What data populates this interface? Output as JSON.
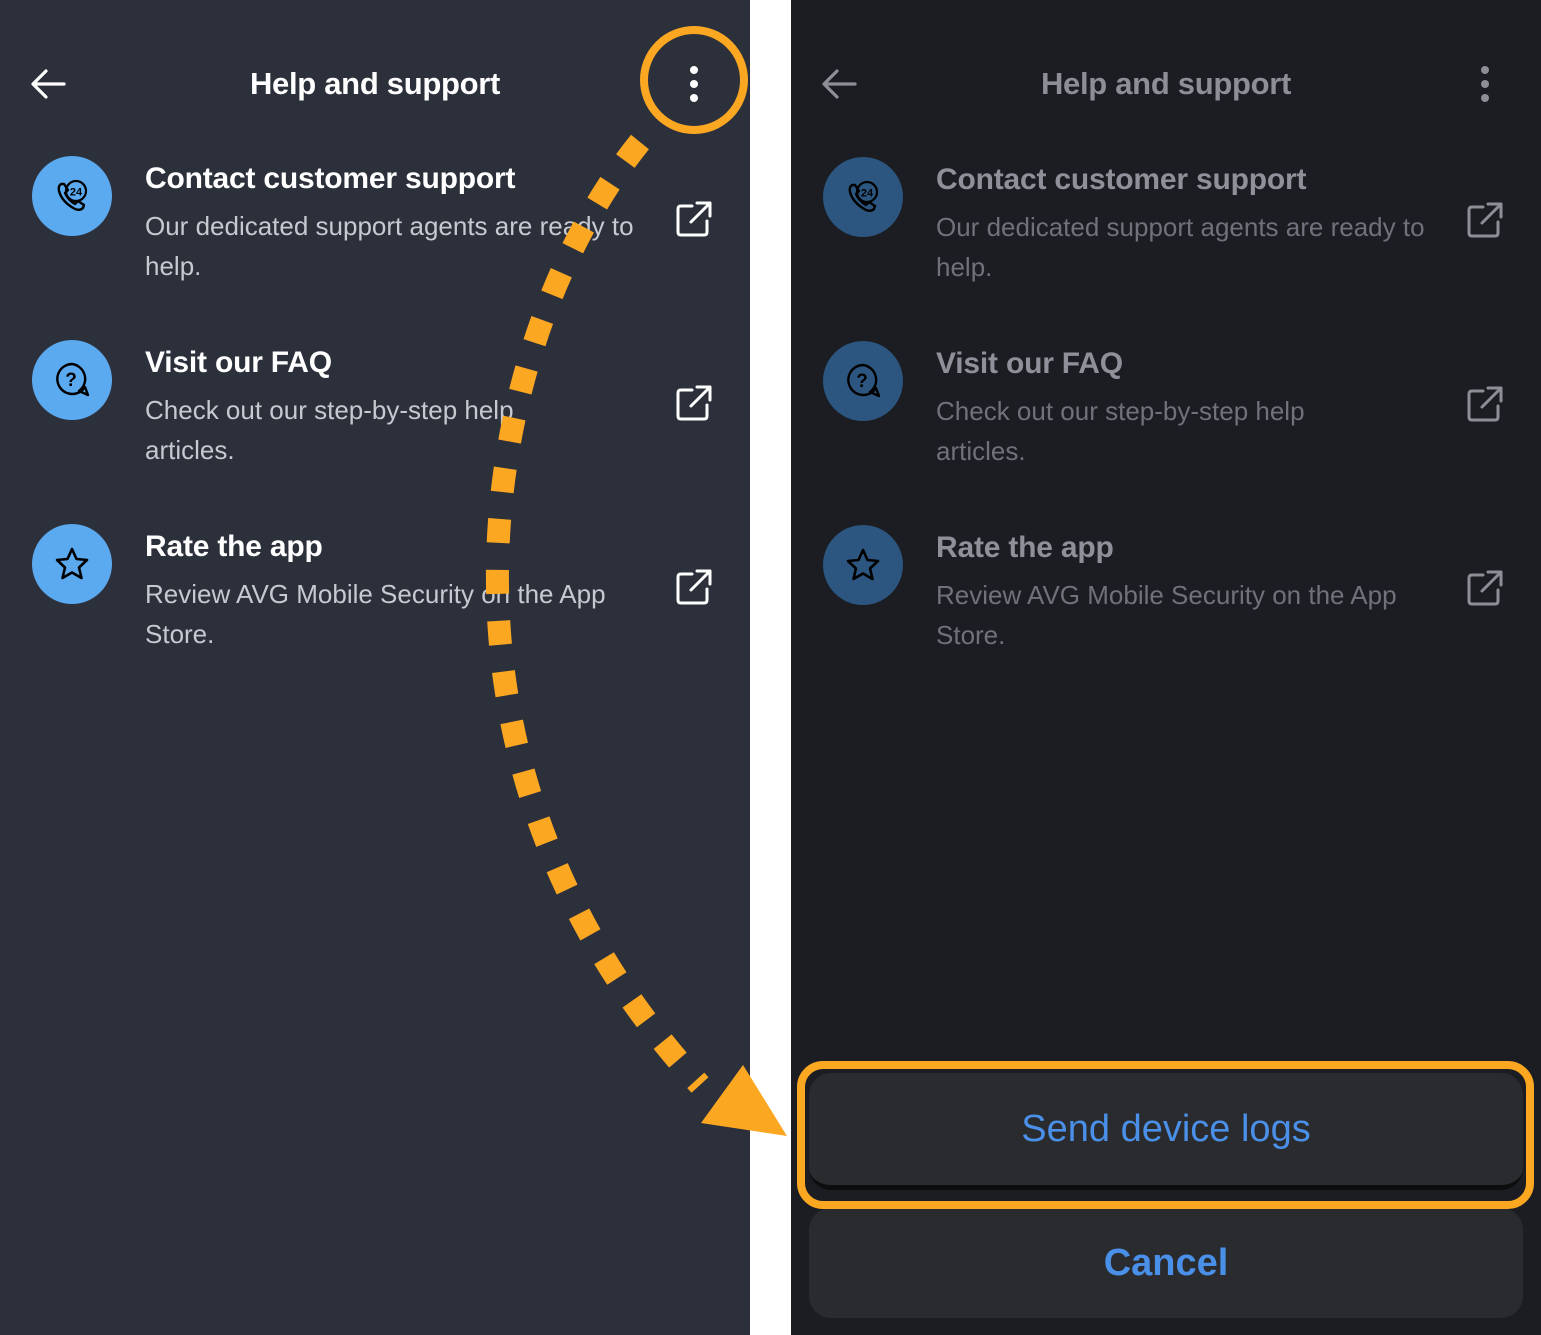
{
  "screen": {
    "title": "Help and support",
    "items": [
      {
        "title": "Contact customer support",
        "description": "Our dedicated support agents are ready to help.",
        "icon": "phone-24-icon"
      },
      {
        "title": "Visit our FAQ",
        "description": "Check out our step-by-step help articles.",
        "icon": "faq-question-icon"
      },
      {
        "title": "Rate the app",
        "description": "Review AVG Mobile Security on the App Store.",
        "icon": "star-icon"
      }
    ]
  },
  "action_sheet": {
    "send_logs_label": "Send device logs",
    "cancel_label": "Cancel"
  },
  "colors": {
    "accent_highlight": "#fca722",
    "icon_circle": "#5ba9ee",
    "link_blue": "#4a8fe8",
    "left_bg": "#2b303b",
    "right_bg": "#1b1d22"
  }
}
